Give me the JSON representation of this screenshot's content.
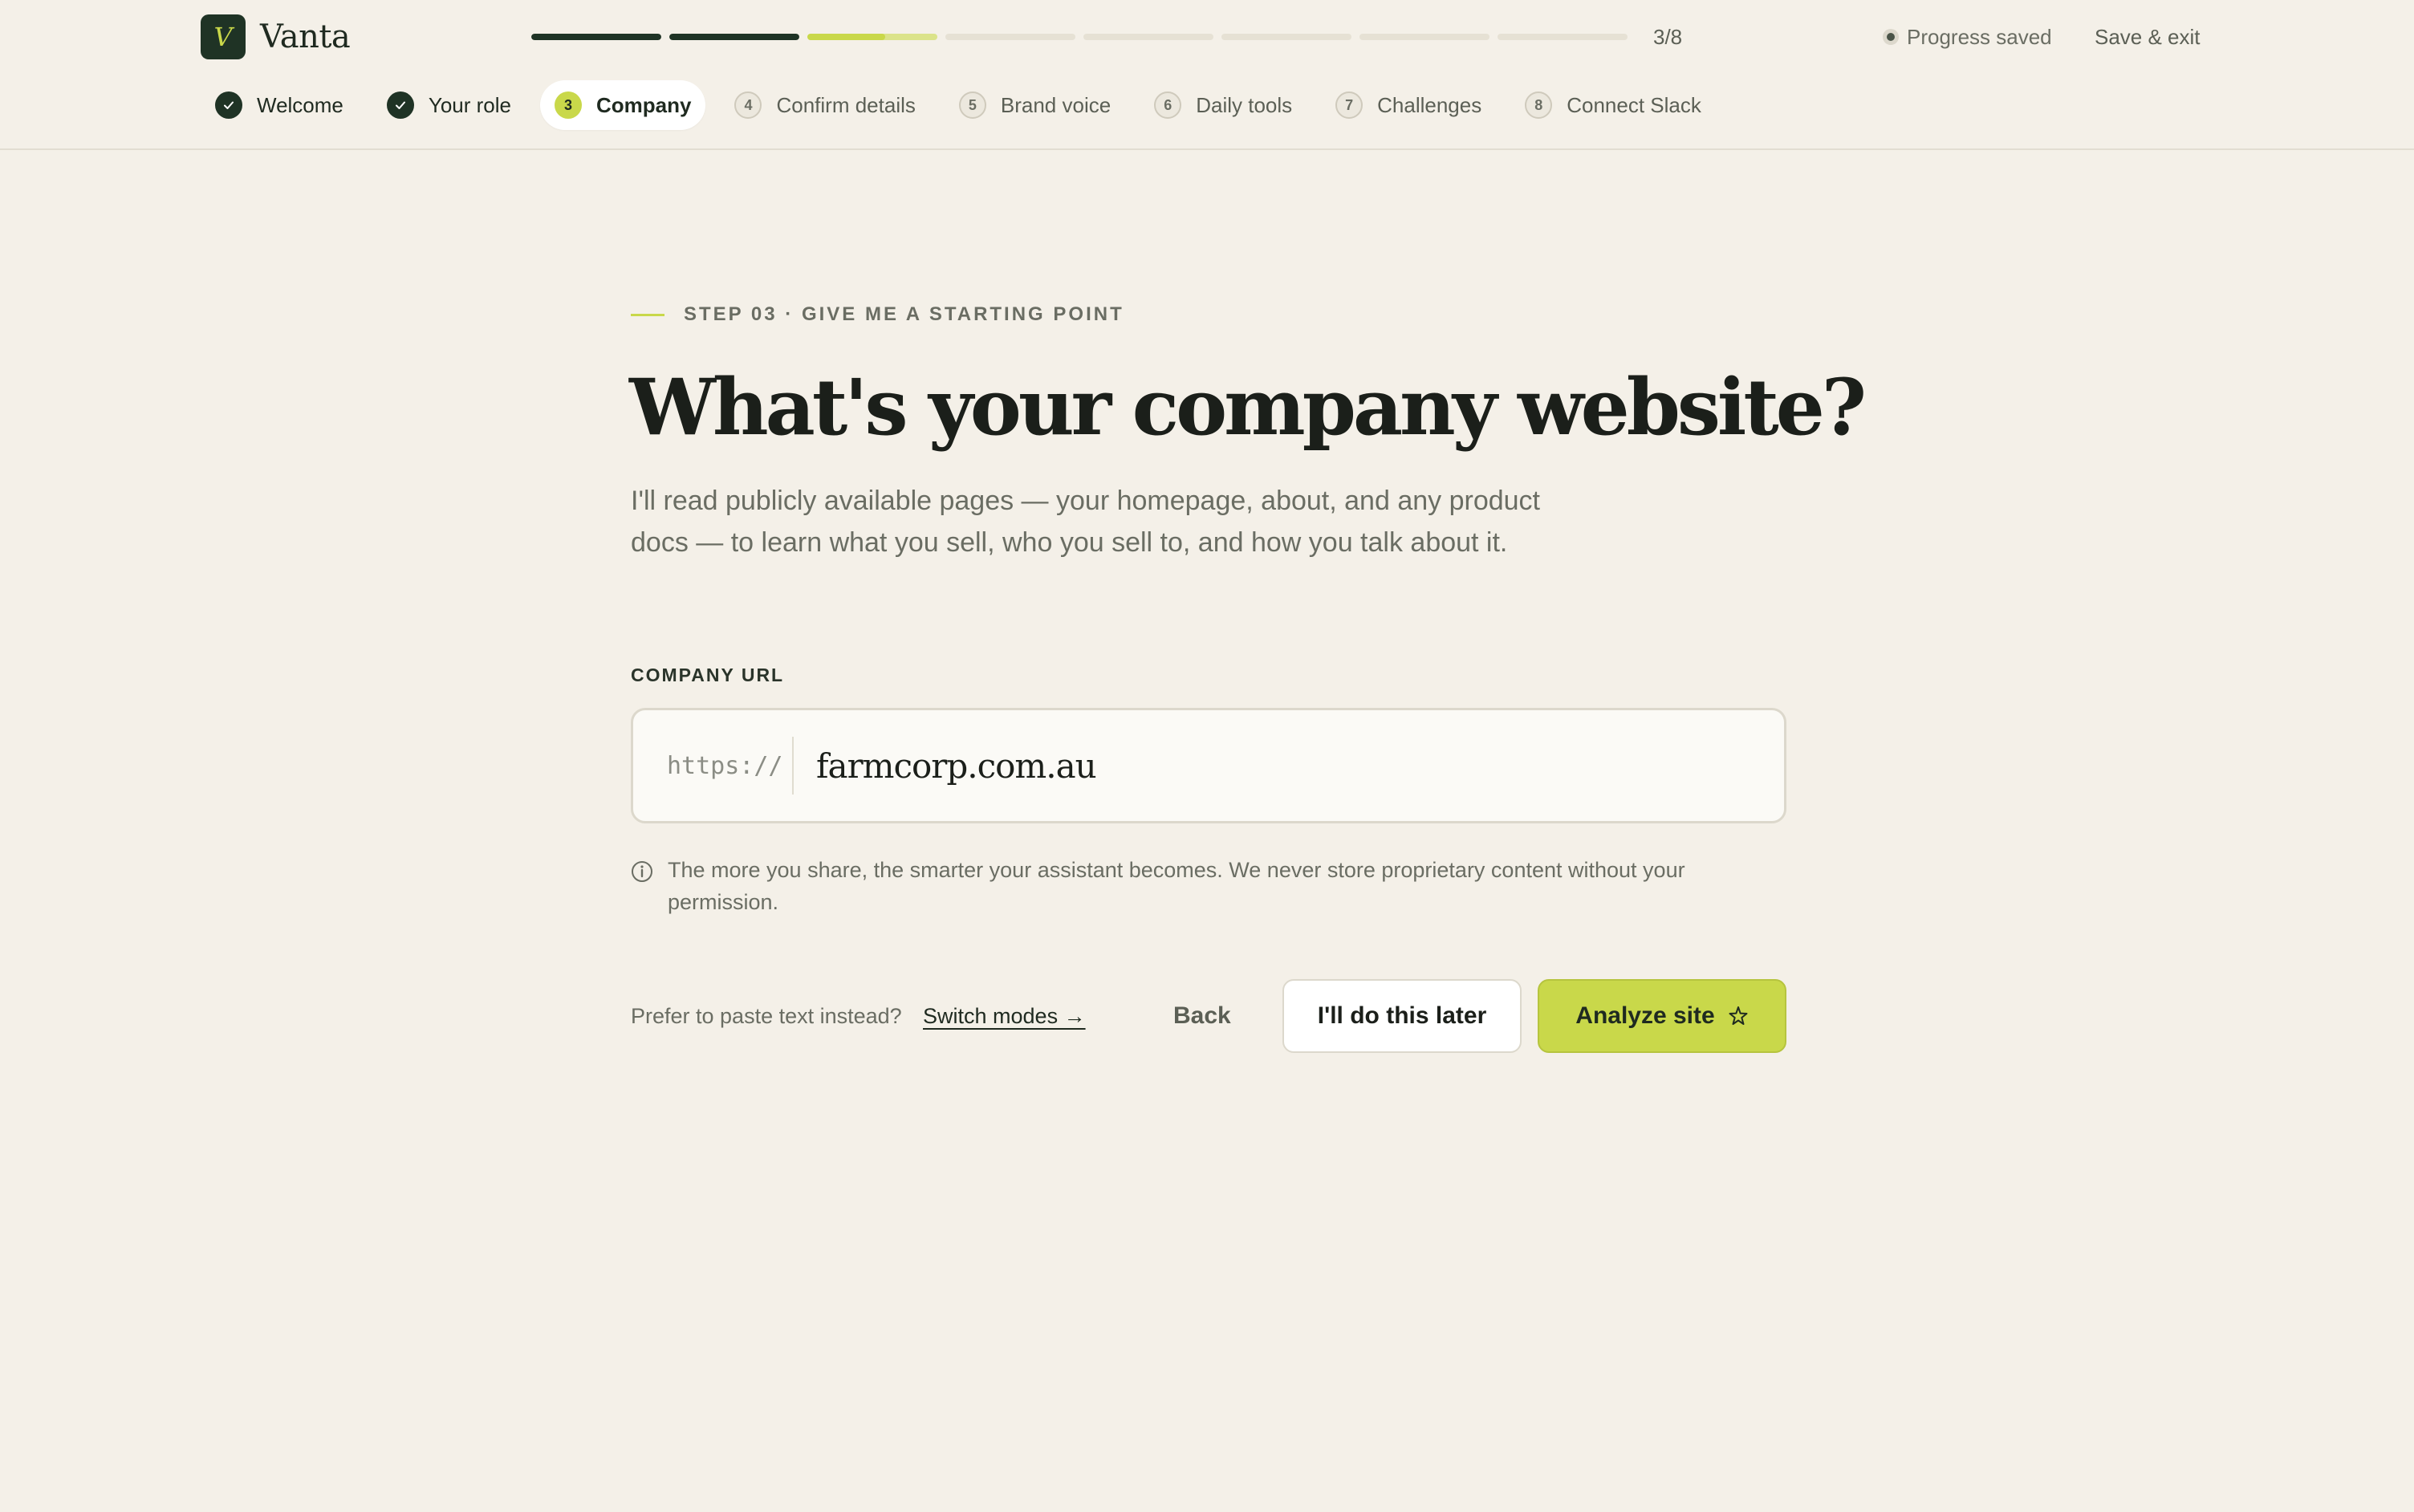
{
  "brand": {
    "logo_letter": "V",
    "name": "Vanta"
  },
  "progress": {
    "count_text": "3/8",
    "segments": [
      1,
      1,
      0.6,
      0,
      0,
      0,
      0,
      0
    ],
    "fill_color_done": "#1f3325",
    "fill_color_active": "#c9d84a",
    "active_remainder_color": "#dbe38a"
  },
  "header": {
    "saved_text": "Progress saved",
    "save_exit_label": "Save & exit"
  },
  "steps": [
    {
      "number": "1",
      "label": "Welcome",
      "state": "done"
    },
    {
      "number": "2",
      "label": "Your role",
      "state": "done"
    },
    {
      "number": "3",
      "label": "Company",
      "state": "active"
    },
    {
      "number": "4",
      "label": "Confirm details",
      "state": "todo"
    },
    {
      "number": "5",
      "label": "Brand voice",
      "state": "todo"
    },
    {
      "number": "6",
      "label": "Daily tools",
      "state": "todo"
    },
    {
      "number": "7",
      "label": "Challenges",
      "state": "todo"
    },
    {
      "number": "8",
      "label": "Connect Slack",
      "state": "todo"
    }
  ],
  "main": {
    "eyebrow": "STEP 03 · GIVE ME A STARTING POINT",
    "title": "What's your company website?",
    "lede": "I'll read publicly available pages — your homepage, about, and any product docs — to learn what you sell, who you sell to, and how you talk about it.",
    "field_label": "COMPANY URL",
    "url_prefix": "https://",
    "url_value": "farmcorp.com.au",
    "hint": "The more you share, the smarter your assistant becomes. We never store proprietary content without your permission."
  },
  "actions": {
    "paste_prompt": "Prefer to paste text instead?",
    "switch_label": "Switch modes →",
    "back_label": "Back",
    "later_label": "I'll do this later",
    "analyze_label": "Analyze site"
  },
  "icons": {
    "check": "check-icon",
    "saved": "status-dot-icon",
    "info": "info-icon",
    "sparkle": "sparkle-icon"
  }
}
